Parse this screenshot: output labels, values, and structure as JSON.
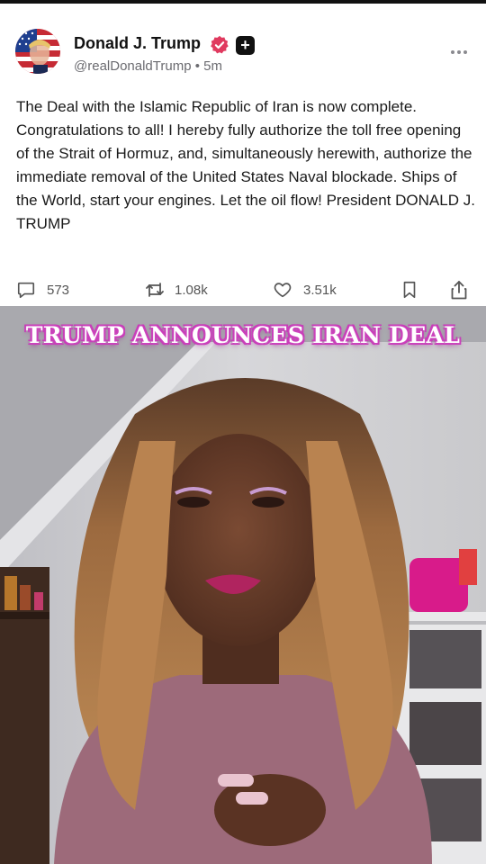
{
  "post": {
    "author_name": "Donald J. Trump",
    "handle": "@realDonaldTrump",
    "separator": "•",
    "time_ago": "5m",
    "body": "The Deal with the Islamic Republic of Iran is now complete. Congratulations to all! I hereby fully authorize the toll free opening of the Strait of Hormuz, and, simultaneously herewith, authorize the immediate removal of the United States Naval blockade. Ships of the World, start your engines. Let the oil flow! President DONALD J. TRUMP",
    "actions": {
      "replies": "573",
      "reposts": "1.08k",
      "likes": "3.51k"
    },
    "icons": {
      "more": "more-options-icon",
      "verified": "verified-badge-icon",
      "plus": "plus-badge-icon",
      "reply": "comment-icon",
      "repost": "repost-icon",
      "like": "heart-icon",
      "bookmark": "bookmark-icon",
      "share": "share-icon"
    }
  },
  "video": {
    "caption": "TRUMP ANNOUNCES IRAN DEAL"
  },
  "colors": {
    "verified": "#e03a5f",
    "caption_outline": "#c73bb8",
    "text": "#1a1a1a",
    "muted": "#6b6b70"
  }
}
